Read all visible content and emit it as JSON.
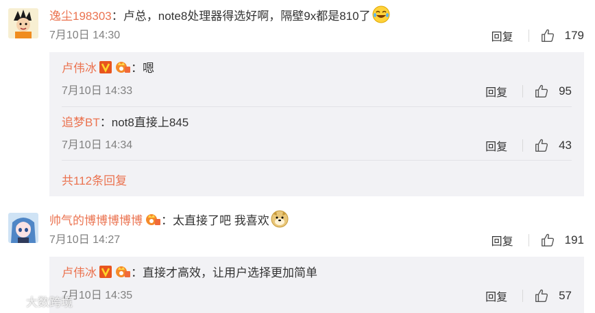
{
  "comments": [
    {
      "username": "逸尘198303",
      "separator": "：",
      "text": "卢总，note8处理器得选好啊，隔壁9x都是810了",
      "emoji": "laugh-cry-emoji",
      "time": "7月10日 14:30",
      "reply_label": "回复",
      "likes": "179",
      "replies": [
        {
          "username": "卢伟冰",
          "separator": "：",
          "text": "嗯",
          "time": "7月10日 14:33",
          "reply_label": "回复",
          "likes": "95"
        },
        {
          "username": "追梦BT",
          "separator": "：",
          "text": "not8直接上845",
          "time": "7月10日 14:34",
          "reply_label": "回复",
          "likes": "43"
        }
      ],
      "more_replies": "共112条回复"
    },
    {
      "username": "帅气的博博博博博",
      "separator": "：",
      "text": "太直接了吧 我喜欢",
      "emoji": "doge-emoji",
      "time": "7月10日 14:27",
      "reply_label": "回复",
      "likes": "191",
      "replies": [
        {
          "username": "卢伟冰",
          "separator": "：",
          "text": "直接才高效，让用户选择更加简单",
          "time": "7月10日 14:35",
          "reply_label": "回复",
          "likes": "57"
        }
      ]
    }
  ],
  "watermark": "大数跨境",
  "colors": {
    "username": "#eb7350",
    "subbox_bg": "#f2f2f5",
    "time": "#808080"
  }
}
